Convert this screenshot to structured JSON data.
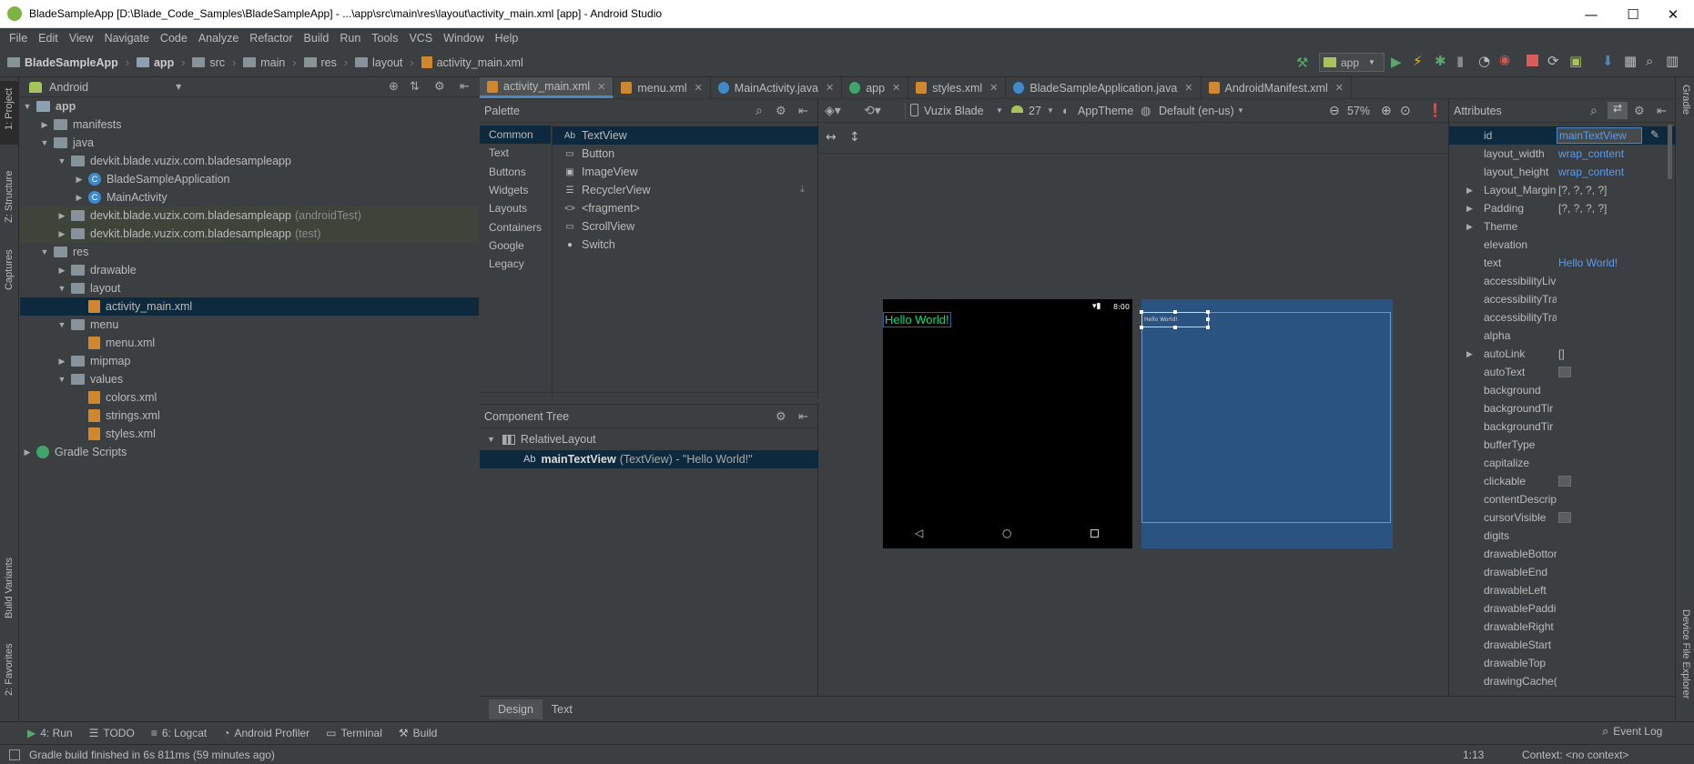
{
  "window": {
    "title": "BladeSampleApp [D:\\Blade_Code_Samples\\BladeSampleApp] - ...\\app\\src\\main\\res\\layout\\activity_main.xml [app] - Android Studio",
    "minimize_label": "—",
    "maximize_label": "☐",
    "close_label": "✕"
  },
  "menu": [
    "File",
    "Edit",
    "View",
    "Navigate",
    "Code",
    "Analyze",
    "Refactor",
    "Build",
    "Run",
    "Tools",
    "VCS",
    "Window",
    "Help"
  ],
  "breadcrumb": [
    "BladeSampleApp",
    "app",
    "src",
    "main",
    "res",
    "layout",
    "activity_main.xml"
  ],
  "toolbar": {
    "run_config": "app"
  },
  "left_stripe": {
    "project": "1: Project",
    "structure": "Z: Structure",
    "captures": "Captures",
    "build_variants": "Build Variants",
    "favorites": "2: Favorites"
  },
  "right_stripe": {
    "gradle": "Gradle",
    "device_explorer": "Device File Explorer"
  },
  "project": {
    "view": "Android",
    "tree": [
      {
        "label": "app",
        "depth": 0,
        "arrow": "▼",
        "icon": "mod",
        "bold": true
      },
      {
        "label": "manifests",
        "depth": 1,
        "arrow": "▶",
        "icon": "folder"
      },
      {
        "label": "java",
        "depth": 1,
        "arrow": "▼",
        "icon": "folder"
      },
      {
        "label": "devkit.blade.vuzix.com.bladesampleapp",
        "depth": 2,
        "arrow": "▼",
        "icon": "folder"
      },
      {
        "label": "BladeSampleApplication",
        "depth": 3,
        "arrow": "▶",
        "icon": "class"
      },
      {
        "label": "MainActivity",
        "depth": 3,
        "arrow": "▶",
        "icon": "class"
      },
      {
        "label": "devkit.blade.vuzix.com.bladesampleapp",
        "suffix": "(androidTest)",
        "depth": 2,
        "arrow": "▶",
        "icon": "folder",
        "tint": true
      },
      {
        "label": "devkit.blade.vuzix.com.bladesampleapp",
        "suffix": "(test)",
        "depth": 2,
        "arrow": "▶",
        "icon": "folder",
        "tint": true
      },
      {
        "label": "res",
        "depth": 1,
        "arrow": "▼",
        "icon": "folder"
      },
      {
        "label": "drawable",
        "depth": 2,
        "arrow": "▶",
        "icon": "folder"
      },
      {
        "label": "layout",
        "depth": 2,
        "arrow": "▼",
        "icon": "folder"
      },
      {
        "label": "activity_main.xml",
        "depth": 3,
        "arrow": "",
        "icon": "xml",
        "selected": true
      },
      {
        "label": "menu",
        "depth": 2,
        "arrow": "▼",
        "icon": "folder"
      },
      {
        "label": "menu.xml",
        "depth": 3,
        "arrow": "",
        "icon": "xml"
      },
      {
        "label": "mipmap",
        "depth": 2,
        "arrow": "▶",
        "icon": "folder"
      },
      {
        "label": "values",
        "depth": 2,
        "arrow": "▼",
        "icon": "folder"
      },
      {
        "label": "colors.xml",
        "depth": 3,
        "arrow": "",
        "icon": "xml"
      },
      {
        "label": "strings.xml",
        "depth": 3,
        "arrow": "",
        "icon": "xml"
      },
      {
        "label": "styles.xml",
        "depth": 3,
        "arrow": "",
        "icon": "xml"
      },
      {
        "label": "Gradle Scripts",
        "depth": 0,
        "arrow": "▶",
        "icon": "gradle"
      }
    ]
  },
  "tabs": [
    {
      "label": "activity_main.xml",
      "icon_color": "#d0872e",
      "active": true
    },
    {
      "label": "menu.xml",
      "icon_color": "#d0872e"
    },
    {
      "label": "MainActivity.java",
      "icon_color": "#3d8bcd"
    },
    {
      "label": "app",
      "icon_color": "#40a56a"
    },
    {
      "label": "styles.xml",
      "icon_color": "#d0872e"
    },
    {
      "label": "BladeSampleApplication.java",
      "icon_color": "#3d8bcd"
    },
    {
      "label": "AndroidManifest.xml",
      "icon_color": "#d0872e"
    }
  ],
  "palette": {
    "title": "Palette",
    "categories": [
      "Common",
      "Text",
      "Buttons",
      "Widgets",
      "Layouts",
      "Containers",
      "Google",
      "Legacy"
    ],
    "items": [
      {
        "label": "TextView",
        "icon": "Ab"
      },
      {
        "label": "Button",
        "icon": "▭"
      },
      {
        "label": "ImageView",
        "icon": "▣"
      },
      {
        "label": "RecyclerView",
        "icon": "☰"
      },
      {
        "label": "<fragment>",
        "icon": "<>"
      },
      {
        "label": "ScrollView",
        "icon": "▭"
      },
      {
        "label": "Switch",
        "icon": "●"
      }
    ]
  },
  "component_tree": {
    "title": "Component Tree",
    "root": "RelativeLayout",
    "child_id": "mainTextView",
    "child_detail": "(TextView) - \"Hello World!\""
  },
  "design_toolbar": {
    "device": "Vuzix Blade",
    "api": "27",
    "theme": "AppTheme",
    "locale": "Default (en-us)",
    "zoom": "57%"
  },
  "preview": {
    "text": "Hello World!",
    "text_color": "#00e676",
    "time": "8:00"
  },
  "attributes": {
    "title": "Attributes",
    "rows": [
      {
        "name": "id",
        "value": "mainTextView",
        "kind": "input"
      },
      {
        "name": "layout_width",
        "value": "wrap_content",
        "kind": "link"
      },
      {
        "name": "layout_height",
        "value": "wrap_content",
        "kind": "link"
      },
      {
        "name": "Layout_Margin",
        "value": "[?, ?, ?, ?]",
        "expand": true
      },
      {
        "name": "Padding",
        "value": "[?, ?, ?, ?]",
        "expand": true
      },
      {
        "name": "Theme",
        "value": "",
        "expand": true
      },
      {
        "name": "elevation",
        "value": ""
      },
      {
        "name": "text",
        "value": "Hello World!",
        "kind": "link"
      },
      {
        "name": "accessibilityLiv",
        "value": ""
      },
      {
        "name": "accessibilityTra",
        "value": ""
      },
      {
        "name": "accessibilityTra",
        "value": ""
      },
      {
        "name": "alpha",
        "value": ""
      },
      {
        "name": "autoLink",
        "value": "[]",
        "expand": true
      },
      {
        "name": "autoText",
        "value": "",
        "kind": "check"
      },
      {
        "name": "background",
        "value": ""
      },
      {
        "name": "backgroundTir",
        "value": ""
      },
      {
        "name": "backgroundTir",
        "value": ""
      },
      {
        "name": "bufferType",
        "value": ""
      },
      {
        "name": "capitalize",
        "value": ""
      },
      {
        "name": "clickable",
        "value": "",
        "kind": "check"
      },
      {
        "name": "contentDescrip",
        "value": ""
      },
      {
        "name": "cursorVisible",
        "value": "",
        "kind": "check"
      },
      {
        "name": "digits",
        "value": ""
      },
      {
        "name": "drawableBottor",
        "value": ""
      },
      {
        "name": "drawableEnd",
        "value": ""
      },
      {
        "name": "drawableLeft",
        "value": ""
      },
      {
        "name": "drawablePaddi",
        "value": ""
      },
      {
        "name": "drawableRight",
        "value": ""
      },
      {
        "name": "drawableStart",
        "value": ""
      },
      {
        "name": "drawableTop",
        "value": ""
      },
      {
        "name": "drawingCache(",
        "value": ""
      }
    ]
  },
  "design_tabs": [
    "Design",
    "Text"
  ],
  "tool_windows": [
    {
      "label": "4: Run",
      "icon": "▶",
      "color": "#59a869"
    },
    {
      "label": "TODO",
      "icon": "☰",
      "color": "#bbbbbb"
    },
    {
      "label": "6: Logcat",
      "icon": "≡",
      "color": "#bbbbbb"
    },
    {
      "label": "Android Profiler",
      "icon": "◔",
      "color": "#bbbbbb"
    },
    {
      "label": "Terminal",
      "icon": "▭",
      "color": "#bbbbbb"
    },
    {
      "label": "Build",
      "icon": "⚒",
      "color": "#bbbbbb"
    }
  ],
  "event_log": "Event Log",
  "status": {
    "message": "Gradle build finished in 6s 811ms (59 minutes ago)",
    "position": "1:13",
    "context": "Context: <no context>"
  }
}
